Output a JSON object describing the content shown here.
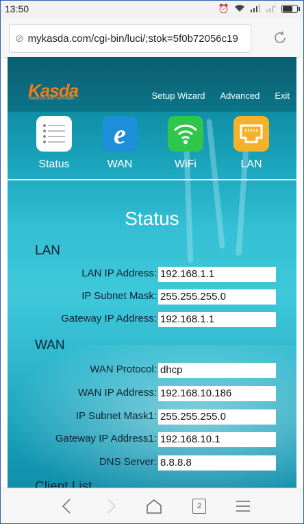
{
  "status_bar": {
    "time": "13:50"
  },
  "address_bar": {
    "url": "mykasda.com/cgi-bin/luci/;stok=5f0b72056c19"
  },
  "router": {
    "logo": "Kasda",
    "logo_sub": "Networks with Innovation",
    "nav": {
      "setup_wizard": "Setup Wizard",
      "advanced": "Advanced",
      "exit": "Exit"
    },
    "tiles": [
      {
        "label": "Status"
      },
      {
        "label": "WAN"
      },
      {
        "label": "WiFi"
      },
      {
        "label": "LAN"
      }
    ],
    "page_title": "Status",
    "lan": {
      "heading": "LAN",
      "rows": [
        {
          "label": "LAN IP Address:",
          "value": "192.168.1.1"
        },
        {
          "label": "IP Subnet Mask:",
          "value": "255.255.255.0"
        },
        {
          "label": "Gateway IP Address:",
          "value": "192.168.1.1"
        }
      ]
    },
    "wan": {
      "heading": "WAN",
      "rows": [
        {
          "label": "WAN Protocol:",
          "value": "dhcp"
        },
        {
          "label": "WAN IP Address:",
          "value": "192.168.10.186"
        },
        {
          "label": "IP Subnet Mask1:",
          "value": "255.255.255.0"
        },
        {
          "label": "Gateway IP Address1:",
          "value": "192.168.10.1"
        },
        {
          "label": "DNS Server:",
          "value": "8.8.8.8"
        }
      ]
    },
    "client_list_heading": "Client List"
  },
  "bottom_nav": {
    "tab_count": "2"
  }
}
